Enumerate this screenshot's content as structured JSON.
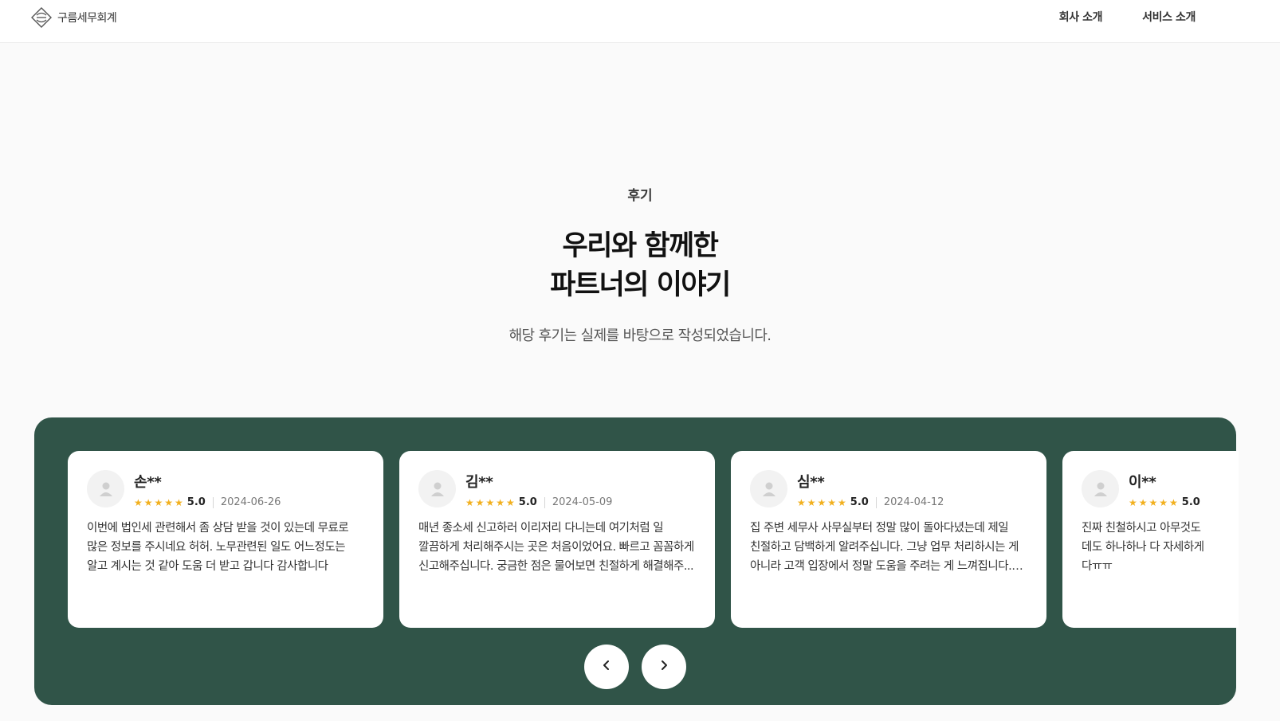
{
  "header": {
    "logo_text": "구름세무회계",
    "nav": [
      {
        "label": "회사 소개"
      },
      {
        "label": "서비스 소개"
      }
    ]
  },
  "hero": {
    "eyebrow": "후기",
    "title_line1": "우리와 함께한",
    "title_line2": "파트너의 이야기",
    "subtitle": "해당 후기는 실제를 바탕으로 작성되었습니다."
  },
  "reviews": [
    {
      "name": "손**",
      "stars": "★★★★★",
      "score": "5.0",
      "date": "2024-06-26",
      "text": "이번에 법인세 관련해서 좀 상담 받을 것이 있는데 무료로 많은 정보를 주시네요 허허. 노무관련된 일도 어느정도는 알고 계시는 것 같아 도움 더 받고 갑니다 감사합니다"
    },
    {
      "name": "김**",
      "stars": "★★★★★",
      "score": "5.0",
      "date": "2024-05-09",
      "text": "매년 종소세 신고하러 이리저리 다니는데 여기처럼 일 깔끔하게 처리해주시는 곳은 처음이었어요. 빠르고 꼼꼼하게 신고해주십니다. 궁금한 점은 물어보면 친절하게 해결해주..."
    },
    {
      "name": "심**",
      "stars": "★★★★★",
      "score": "5.0",
      "date": "2024-04-12",
      "text": "집 주변 세무사 사무실부터 정말 많이 돌아다녔는데 제일 친절하고 담백하게 알려주십니다. 그냥 업무 처리하시는 게 아니라 고객 입장에서 정말 도움을 주려는 게 느껴집니다. 살..."
    },
    {
      "name": "이**",
      "stars": "★★★★★",
      "score": "5.0",
      "date": "",
      "text": "진짜 친철하시고 아무것도\n데도 하나하나 다 자세하게\n다ㅠㅠ"
    }
  ],
  "controls": {
    "prev_icon": "chevron-left-icon",
    "next_icon": "chevron-right-icon"
  },
  "colors": {
    "panel": "#305448",
    "star": "#f2b01e"
  }
}
